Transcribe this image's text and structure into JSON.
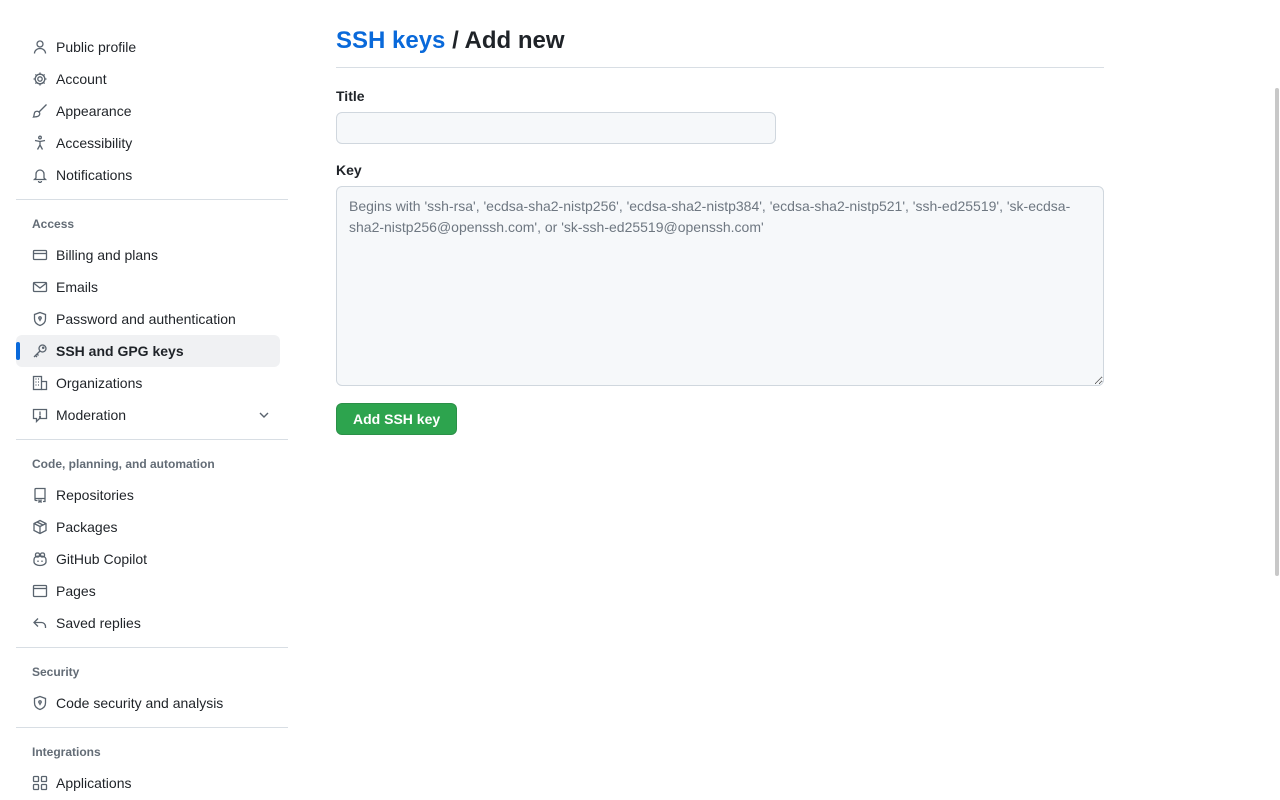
{
  "sidebar": {
    "top_items": [
      {
        "label": "Public profile",
        "icon": "person-icon"
      },
      {
        "label": "Account",
        "icon": "gear-icon"
      },
      {
        "label": "Appearance",
        "icon": "paintbrush-icon"
      },
      {
        "label": "Accessibility",
        "icon": "accessibility-icon"
      },
      {
        "label": "Notifications",
        "icon": "bell-icon"
      }
    ],
    "access": {
      "title": "Access",
      "items": [
        {
          "label": "Billing and plans",
          "icon": "credit-card-icon"
        },
        {
          "label": "Emails",
          "icon": "mail-icon"
        },
        {
          "label": "Password and authentication",
          "icon": "shield-lock-icon"
        },
        {
          "label": "SSH and GPG keys",
          "icon": "key-icon",
          "active": true
        },
        {
          "label": "Organizations",
          "icon": "organization-icon"
        },
        {
          "label": "Moderation",
          "icon": "report-icon",
          "expandable": true
        }
      ]
    },
    "code": {
      "title": "Code, planning, and automation",
      "items": [
        {
          "label": "Repositories",
          "icon": "repo-icon"
        },
        {
          "label": "Packages",
          "icon": "package-icon"
        },
        {
          "label": "GitHub Copilot",
          "icon": "copilot-icon"
        },
        {
          "label": "Pages",
          "icon": "browser-icon"
        },
        {
          "label": "Saved replies",
          "icon": "reply-icon"
        }
      ]
    },
    "security": {
      "title": "Security",
      "items": [
        {
          "label": "Code security and analysis",
          "icon": "shield-lock-icon"
        }
      ]
    },
    "integrations": {
      "title": "Integrations",
      "items": [
        {
          "label": "Applications",
          "icon": "apps-icon"
        }
      ]
    }
  },
  "main": {
    "breadcrumb_link": "SSH keys",
    "breadcrumb_sep": " / ",
    "breadcrumb_current": "Add new",
    "title_label": "Title",
    "title_value": "",
    "key_label": "Key",
    "key_placeholder": "Begins with 'ssh-rsa', 'ecdsa-sha2-nistp256', 'ecdsa-sha2-nistp384', 'ecdsa-sha2-nistp521', 'ssh-ed25519', 'sk-ecdsa-sha2-nistp256@openssh.com', or 'sk-ssh-ed25519@openssh.com'",
    "submit_label": "Add SSH key"
  },
  "colors": {
    "accent": "#0969da",
    "primary_button": "#2da44e",
    "active_bg": "#f0f1f3"
  }
}
